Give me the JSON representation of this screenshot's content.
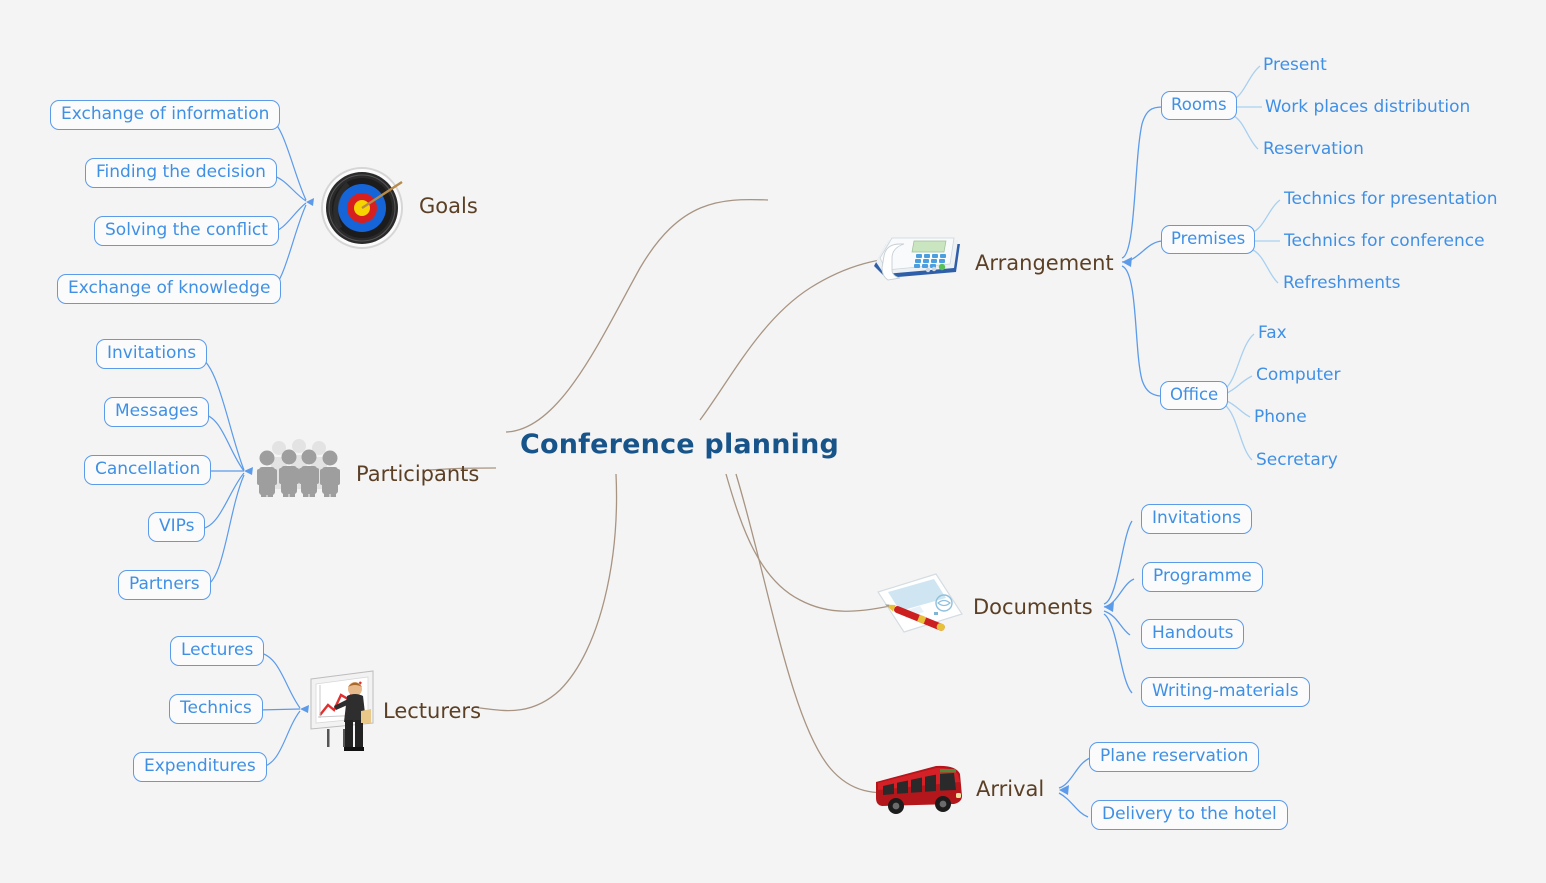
{
  "central": {
    "title": "Conference planning",
    "color": "#17548a"
  },
  "theme": {
    "background": "#f4f4f4",
    "box_border": "#5b9bea",
    "box_text": "#3f90e5",
    "branch_label": "#5b4026",
    "main_connector": "#a89482",
    "sub_connector": "#5b9bea",
    "leaf_connector": "#a8d0f0"
  },
  "branches": [
    {
      "id": "goals",
      "label": "Goals",
      "icon": "target-icon",
      "side": "left",
      "children": [
        {
          "label": "Exchange of information",
          "boxed": true
        },
        {
          "label": "Finding the decision",
          "boxed": true
        },
        {
          "label": "Solving the conflict",
          "boxed": true
        },
        {
          "label": "Exchange of knowledge",
          "boxed": true
        }
      ]
    },
    {
      "id": "participants",
      "label": "Participants",
      "icon": "people-group-icon",
      "side": "left",
      "children": [
        {
          "label": "Invitations",
          "boxed": true
        },
        {
          "label": "Messages",
          "boxed": true
        },
        {
          "label": "Cancellation",
          "boxed": true
        },
        {
          "label": "VIPs",
          "boxed": true
        },
        {
          "label": "Partners",
          "boxed": true
        }
      ]
    },
    {
      "id": "lecturers",
      "label": "Lecturers",
      "icon": "presenter-flipchart-icon",
      "side": "left",
      "children": [
        {
          "label": "Lectures",
          "boxed": true
        },
        {
          "label": "Technics",
          "boxed": true
        },
        {
          "label": "Expenditures",
          "boxed": true
        }
      ]
    },
    {
      "id": "arrangement",
      "label": "Arrangement",
      "icon": "fax-phone-icon",
      "side": "right",
      "children": [
        {
          "label": "Rooms",
          "boxed": true,
          "children": [
            {
              "label": "Present"
            },
            {
              "label": "Work places distribution"
            },
            {
              "label": "Reservation"
            }
          ]
        },
        {
          "label": "Premises",
          "boxed": true,
          "children": [
            {
              "label": "Technics for presentation"
            },
            {
              "label": "Technics for conference"
            },
            {
              "label": "Refreshments"
            }
          ]
        },
        {
          "label": "Office",
          "boxed": true,
          "children": [
            {
              "label": "Fax"
            },
            {
              "label": "Computer"
            },
            {
              "label": "Phone"
            },
            {
              "label": "Secretary"
            }
          ]
        }
      ]
    },
    {
      "id": "documents",
      "label": "Documents",
      "icon": "document-pen-icon",
      "side": "right",
      "children": [
        {
          "label": "Invitations",
          "boxed": true
        },
        {
          "label": "Programme",
          "boxed": true
        },
        {
          "label": "Handouts",
          "boxed": true
        },
        {
          "label": "Writing-materials",
          "boxed": true
        }
      ]
    },
    {
      "id": "arrival",
      "label": "Arrival",
      "icon": "bus-icon",
      "side": "right",
      "children": [
        {
          "label": "Plane reservation",
          "boxed": true
        },
        {
          "label": "Delivery to the hotel",
          "boxed": true
        }
      ]
    }
  ]
}
